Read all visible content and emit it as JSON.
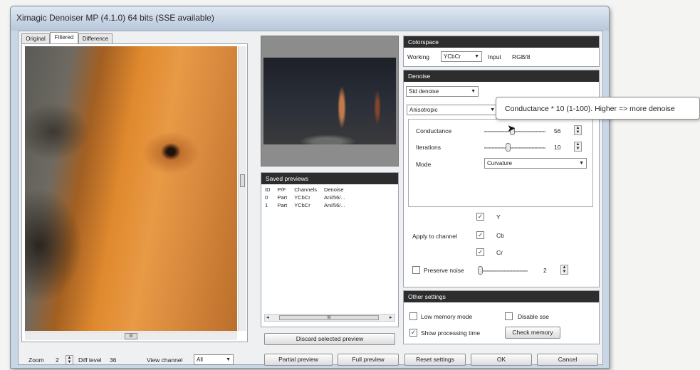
{
  "window": {
    "title": "Ximagic Denoiser MP (4.1.0) 64 bits (SSE available)"
  },
  "tabs": [
    {
      "label": "Original"
    },
    {
      "label": "Filtered"
    },
    {
      "label": "Difference"
    }
  ],
  "bottom": {
    "zoom_label": "Zoom",
    "zoom_value": "2",
    "difflevel_label": "Diff level",
    "difflevel_value": "36",
    "view_channel_label": "View channel",
    "view_channel_value": "All",
    "partial_preview": "Partial preview",
    "full_preview": "Full preview",
    "reset_settings": "Reset settings",
    "ok": "OK",
    "cancel": "Cancel"
  },
  "saved_previews": {
    "header": "Saved previews",
    "columns": [
      "ID",
      "P/F",
      "Channels",
      "Denoise"
    ],
    "rows": [
      [
        "0",
        "Part",
        "YCbCr",
        "Ani/56/..."
      ],
      [
        "1",
        "Part",
        "YCbCr",
        "Ani/56/..."
      ]
    ],
    "scroll_label": "III",
    "discard_button": "Discard selected preview"
  },
  "colorspace": {
    "header": "Colorspace",
    "working_label": "Working",
    "working_value": "YCbCr",
    "input_label": "Input",
    "input_value": "RGB/8"
  },
  "denoise": {
    "header": "Denoise",
    "method": "Std denoise",
    "algorithm": "Anisotropic",
    "conductance_label": "Conductance",
    "conductance_value": "56",
    "iterations_label": "Iterations",
    "iterations_value": "10",
    "mode_label": "Mode",
    "mode_value": "Curvature",
    "apply_label": "Apply to channel",
    "channels": [
      {
        "name": "Y",
        "checked": true
      },
      {
        "name": "Cb",
        "checked": true
      },
      {
        "name": "Cr",
        "checked": true
      }
    ],
    "preserve_noise_label": "Preserve noise",
    "preserve_noise_value": "2"
  },
  "tooltip": {
    "text": "Conductance * 10 (1-100). Higher => more denoise"
  },
  "other": {
    "header": "Other settings",
    "low_memory": "Low memory mode",
    "disable_sse": "Disable sse",
    "show_time": "Show processing time",
    "check_memory": "Check memory"
  },
  "image_scroll_label": "III"
}
